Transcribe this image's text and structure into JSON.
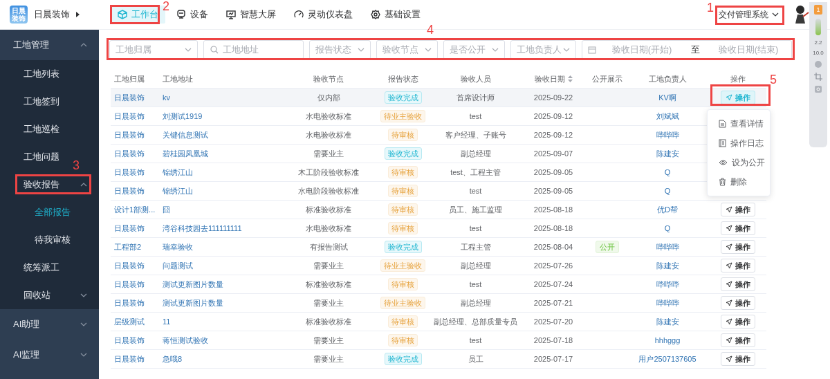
{
  "header": {
    "logo_text": "日晨装饰",
    "company": "日晨装饰",
    "nav": [
      {
        "label": "工作台",
        "selected": true
      },
      {
        "label": "设备",
        "selected": false
      },
      {
        "label": "智慧大屏",
        "selected": false
      },
      {
        "label": "灵动仪表盘",
        "selected": false
      },
      {
        "label": "基础设置",
        "selected": false
      }
    ],
    "system_switch": {
      "label": "交付管理系统",
      "expanded": false
    }
  },
  "sidebar": [
    {
      "label": "工地管理",
      "expanded": true,
      "children": [
        {
          "label": "工地列表",
          "selected": false
        },
        {
          "label": "工地签到",
          "selected": false
        },
        {
          "label": "工地巡检",
          "selected": false
        },
        {
          "label": "工地问题",
          "selected": false
        },
        {
          "label": "验收报告",
          "selected": false,
          "expanded": true,
          "children": [
            {
              "label": "全部报告",
              "selected": true
            },
            {
              "label": "待我审核",
              "selected": false
            }
          ]
        },
        {
          "label": "统筹派工",
          "selected": false
        },
        {
          "label": "回收站",
          "selected": false,
          "expanded": false
        }
      ]
    },
    {
      "label": "AI助理",
      "expanded": false
    },
    {
      "label": "AI监理",
      "expanded": false
    }
  ],
  "filters": [
    {
      "kind": "select",
      "placeholder": "工地归属"
    },
    {
      "kind": "search",
      "placeholder": "工地地址"
    },
    {
      "kind": "select",
      "placeholder": "报告状态"
    },
    {
      "kind": "select",
      "placeholder": "验收节点"
    },
    {
      "kind": "select",
      "placeholder": "是否公开"
    },
    {
      "kind": "select",
      "placeholder": "工地负责人"
    },
    {
      "kind": "daterange",
      "placeholder": "验收日期(开始)",
      "separator": "至",
      "placeholder_end": "验收日期(结束)"
    }
  ],
  "table": {
    "columns": [
      "工地归属",
      "工地地址",
      "验收节点",
      "报告状态",
      "验收人员",
      "验收日期",
      "公开展示",
      "工地负责人",
      "操作"
    ],
    "rows": [
      {
        "owner": "日晨装饰",
        "address": "kv",
        "node": "仅内部",
        "status": "验收完成",
        "kind": "success",
        "inspector": "首席设计师",
        "date": "2025-09-22",
        "public": false,
        "manager": "KV啊",
        "action": "操作",
        "highlighted": true
      },
      {
        "owner": "日晨装饰",
        "address": "刘测试1919",
        "node": "水电验收标准",
        "status": "待业主验收",
        "kind": "warning",
        "inspector": "test",
        "date": "2025-09-12",
        "public": false,
        "manager": "刘斌斌",
        "highlighted": false
      },
      {
        "owner": "日晨装饰",
        "address": "关键信息测试",
        "node": "水电验收标准",
        "status": "待审核",
        "kind": "warning",
        "inspector": "客户经理、子账号",
        "date": "2025-09-12",
        "public": false,
        "manager": "哔哔哔",
        "highlighted": false
      },
      {
        "owner": "日晨装饰",
        "address": "碧桂园凤凰城",
        "node": "需要业主",
        "status": "验收完成",
        "kind": "success",
        "inspector": "副总经理",
        "date": "2025-09-07",
        "public": false,
        "manager": "陈建安",
        "highlighted": false
      },
      {
        "owner": "日晨装饰",
        "address": "锦绣江山",
        "node": "木工阶段验收标准",
        "status": "待审核",
        "kind": "warning",
        "inspector": "test、工程主管",
        "date": "2025-09-05",
        "public": false,
        "manager": "Q",
        "highlighted": false
      },
      {
        "owner": "日晨装饰",
        "address": "锦绣江山",
        "node": "水电阶段验收标准",
        "status": "待审核",
        "kind": "warning",
        "inspector": "test",
        "date": "2025-09-05",
        "public": false,
        "manager": "Q",
        "highlighted": false
      },
      {
        "owner": "设计1部测...",
        "address": "囧",
        "node": "标准验收标准",
        "status": "待审核",
        "kind": "warning",
        "inspector": "员工、施工监理",
        "date": "2025-08-18",
        "public": false,
        "manager": "优D帮",
        "action": "操作",
        "highlighted": false
      },
      {
        "owner": "日晨装饰",
        "address": "湾谷科技园去111111111",
        "node": "水电验收标准",
        "status": "待审核",
        "kind": "warning",
        "inspector": "test",
        "date": "2025-08-18",
        "public": false,
        "manager": "Q",
        "action": "操作",
        "highlighted": false
      },
      {
        "owner": "工程部2",
        "address": "瑞幸验收",
        "node": "有报告测试",
        "status": "验收完成",
        "kind": "success",
        "inspector": "工程主管",
        "date": "2025-08-04",
        "public": true,
        "public_label": "公开",
        "manager": "哔哔哔",
        "action": "操作",
        "highlighted": false
      },
      {
        "owner": "日晨装饰",
        "address": "问题测试",
        "node": "需要业主",
        "status": "待业主验收",
        "kind": "warning",
        "inspector": "副总经理",
        "date": "2025-07-26",
        "public": false,
        "manager": "陈建安",
        "action": "操作",
        "highlighted": false
      },
      {
        "owner": "日晨装饰",
        "address": "测试更新图片数量",
        "node": "标准验收标准",
        "status": "待审核",
        "kind": "warning",
        "inspector": "test",
        "date": "2025-07-24",
        "public": false,
        "manager": "哔哔哔",
        "action": "操作",
        "highlighted": false
      },
      {
        "owner": "日晨装饰",
        "address": "测试更新图片数量",
        "node": "需要业主",
        "status": "待业主验收",
        "kind": "warning",
        "inspector": "副总经理",
        "date": "2025-07-21",
        "public": false,
        "manager": "哔哔哔",
        "action": "操作",
        "highlighted": false
      },
      {
        "owner": "层级测试",
        "address": "11",
        "node": "标准验收标准",
        "status": "待审核",
        "kind": "warning",
        "inspector": "副总经理、总部质量专员",
        "date": "2025-07-20",
        "public": false,
        "manager": "陈建安",
        "action": "操作",
        "highlighted": false
      },
      {
        "owner": "日晨装饰",
        "address": "蒋恒测试验收",
        "node": "需要业主",
        "status": "待审核",
        "kind": "warning",
        "inspector": "test",
        "date": "2025-07-18",
        "public": false,
        "manager": "hhhggg",
        "action": "操作",
        "highlighted": false
      },
      {
        "owner": "日晨装饰",
        "address": "急哦8",
        "node": "需要业主",
        "status": "验收完成",
        "kind": "success",
        "inspector": "员工",
        "date": "2025-07-17",
        "public": false,
        "manager": "用户2507137605",
        "action": "操作",
        "highlighted": false
      }
    ]
  },
  "action_menu": [
    {
      "label": "查看详情"
    },
    {
      "label": "操作日志"
    },
    {
      "label": "设为公开"
    },
    {
      "label": "删除"
    }
  ],
  "side_toolbar": {
    "badge": "1",
    "readings": [
      "2.2",
      "10.0"
    ]
  },
  "annotations": [
    {
      "label": "1"
    },
    {
      "label": "2"
    },
    {
      "label": "3"
    },
    {
      "label": "4"
    },
    {
      "label": "5"
    }
  ]
}
